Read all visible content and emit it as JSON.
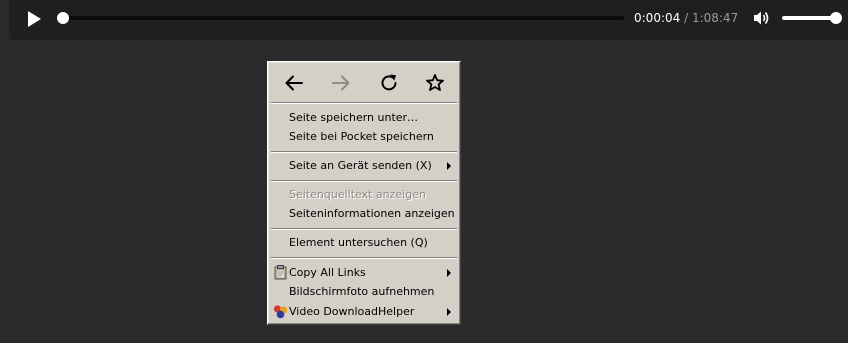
{
  "player": {
    "current_time": "0:00:04",
    "separator": " / ",
    "duration": "1:08:47",
    "progress_fraction": 0.001,
    "volume_fraction": 1.0,
    "icons": {
      "play": "play-icon",
      "volume": "volume-icon"
    }
  },
  "context_menu": {
    "nav_icons": [
      "back-arrow-icon",
      "forward-arrow-icon",
      "reload-icon",
      "bookmark-star-icon"
    ],
    "items": [
      {
        "label": "Seite speichern unter…",
        "disabled": false,
        "submenu": false
      },
      {
        "label": "Seite bei Pocket speichern",
        "disabled": false,
        "submenu": false
      },
      {
        "label": "Seite an Gerät senden (X)",
        "disabled": false,
        "submenu": true
      },
      {
        "label": "Seitenquelltext anzeigen",
        "disabled": true,
        "submenu": false
      },
      {
        "label": "Seiteninformationen anzeigen",
        "disabled": false,
        "submenu": false
      },
      {
        "label": "Element untersuchen (Q)",
        "disabled": false,
        "submenu": false
      },
      {
        "label": "Copy All Links",
        "disabled": false,
        "submenu": true,
        "icon": "clipboard-icon"
      },
      {
        "label": "Bildschirmfoto aufnehmen",
        "disabled": false,
        "submenu": false
      },
      {
        "label": "Video DownloadHelper",
        "disabled": false,
        "submenu": true,
        "icon": "video-downloadhelper-icon"
      }
    ]
  },
  "colors": {
    "menu_bg": "#d4d0c8",
    "page_bg": "#2a2a2a",
    "player_bg": "#1f1f1f",
    "disabled_text": "#8f8c86"
  }
}
